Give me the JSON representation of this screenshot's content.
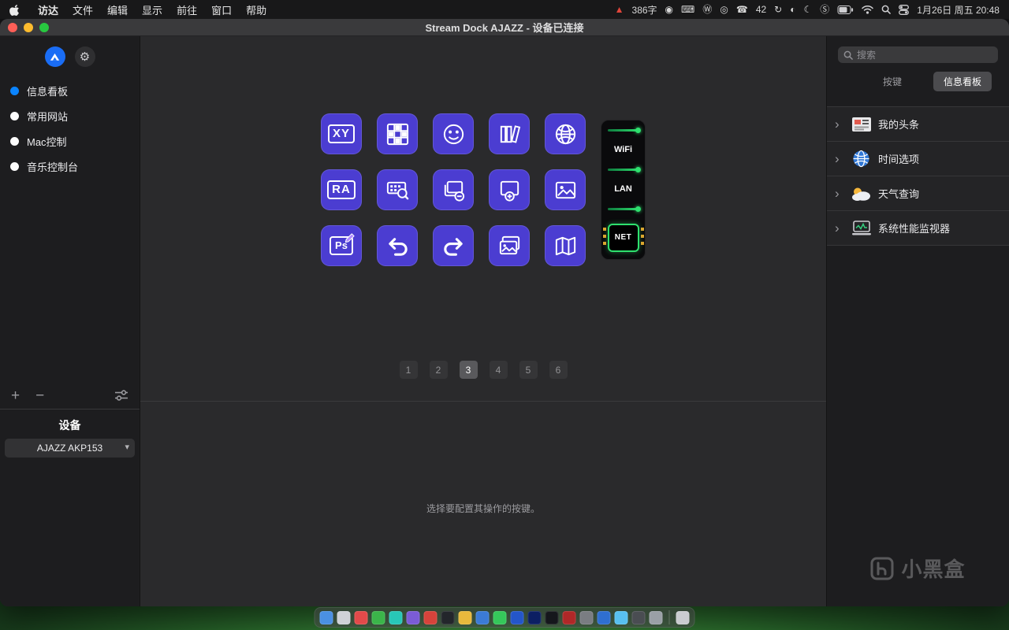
{
  "menu_bar": {
    "menus": [
      "访达",
      "文件",
      "编辑",
      "显示",
      "前往",
      "窗口",
      "帮助"
    ],
    "status_items": [
      {
        "name": "recording-warning-icon",
        "glyph": "▲",
        "color": "#e0453a"
      },
      {
        "name": "word-count-label",
        "text": "386字"
      },
      {
        "name": "mic-icon",
        "glyph": "◉"
      },
      {
        "name": "input-source-icon",
        "glyph": "⌨"
      },
      {
        "name": "wikipedia-icon",
        "glyph": "Ⓦ"
      },
      {
        "name": "screen-record-icon",
        "glyph": "◎"
      },
      {
        "name": "wechat-icon",
        "glyph": "☎"
      },
      {
        "name": "battery-health-label",
        "text": "42"
      },
      {
        "name": "sync-icon",
        "glyph": "↻"
      },
      {
        "name": "display-icon",
        "glyph": "◐"
      },
      {
        "name": "focus-moon-icon",
        "glyph": "☾"
      },
      {
        "name": "s-app-icon",
        "glyph": "Ⓢ"
      },
      {
        "name": "battery-icon",
        "svg": "battery"
      },
      {
        "name": "wifi-icon",
        "svg": "wifi"
      },
      {
        "name": "spotlight-search-icon",
        "svg": "search"
      },
      {
        "name": "control-center-icon",
        "svg": "control-center"
      },
      {
        "name": "clock-label",
        "text": "1月26日 周五 20:48"
      }
    ]
  },
  "window": {
    "title": "Stream Dock AJAZZ - 设备已连接"
  },
  "left_sidebar": {
    "profiles": [
      {
        "label": "信息看板",
        "selected": true
      },
      {
        "label": "常用网站",
        "selected": false
      },
      {
        "label": "Mac控制",
        "selected": false
      },
      {
        "label": "音乐控制台",
        "selected": false
      }
    ],
    "device": {
      "heading": "设备",
      "selected": "AJAZZ AKP153"
    }
  },
  "main": {
    "keys": [
      {
        "name": "xy-pad-key",
        "label": "XY",
        "icon": "box"
      },
      {
        "name": "pixel-grid-key",
        "icon": "grid"
      },
      {
        "name": "avatar-face-key",
        "icon": "face"
      },
      {
        "name": "library-books-key",
        "icon": "books"
      },
      {
        "name": "globe-key",
        "icon": "globe"
      },
      {
        "name": "ra-key",
        "label": "RA",
        "icon": "box"
      },
      {
        "name": "keyboard-search-key",
        "icon": "keyboard-search"
      },
      {
        "name": "window-remove-key",
        "icon": "window-minus"
      },
      {
        "name": "window-add-key",
        "icon": "window-plus"
      },
      {
        "name": "image-key",
        "icon": "image"
      },
      {
        "name": "ps-edit-key",
        "label": "Ps",
        "icon": "ps"
      },
      {
        "name": "undo-key",
        "icon": "undo"
      },
      {
        "name": "redo-key",
        "icon": "redo"
      },
      {
        "name": "photos-stack-key",
        "icon": "photos"
      },
      {
        "name": "map-key",
        "icon": "map"
      }
    ],
    "network_widget": {
      "labels": [
        "WiFi",
        "LAN",
        "NET"
      ]
    },
    "pagination": {
      "pages": [
        "1",
        "2",
        "3",
        "4",
        "5",
        "6"
      ],
      "active": "3"
    },
    "hint": "选择要配置其操作的按键。"
  },
  "right_panel": {
    "search_placeholder": "搜索",
    "tabs": [
      {
        "label": "按键",
        "active": false
      },
      {
        "label": "信息看板",
        "active": true
      }
    ],
    "categories": [
      {
        "label": "我的头条",
        "icon": "headlines"
      },
      {
        "label": "时间选项",
        "icon": "time"
      },
      {
        "label": "天气查询",
        "icon": "weather"
      },
      {
        "label": "系统性能监视器",
        "icon": "monitor"
      }
    ],
    "watermark": "小黑盒"
  },
  "dock": {
    "app_colors": [
      "#4a90e2",
      "#cfd2d6",
      "#e24a4a",
      "#3bb54a",
      "#28c7b7",
      "#7b5cd6",
      "#d6433b",
      "#23262b",
      "#e8b93c",
      "#3b7bd6",
      "#35c75a",
      "#2456c9",
      "#0c1f63",
      "#15171c",
      "#b02828",
      "#7a7d82",
      "#2f6fd0",
      "#58c0f0",
      "#4a4d52",
      "#9aa0a6",
      "#caccd0"
    ]
  }
}
